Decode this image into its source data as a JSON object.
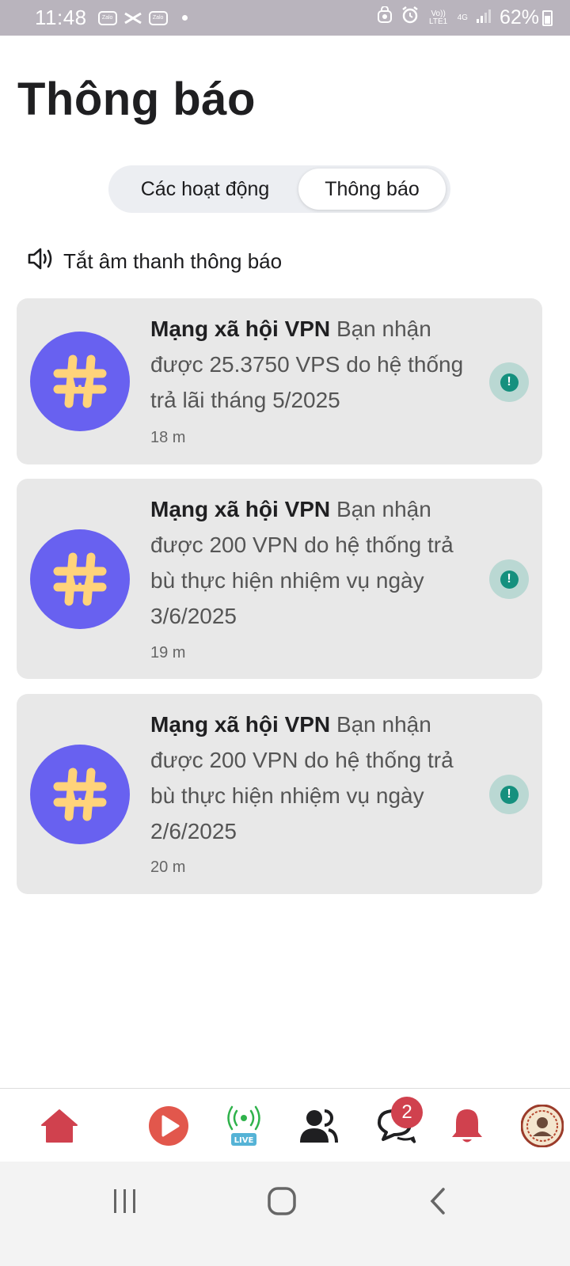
{
  "status_bar": {
    "time": "11:48",
    "notification_icons": [
      "zalo-icon",
      "capcut-icon",
      "zalo-icon"
    ],
    "volte_label": "Vo)) LTE1",
    "network_label": "4G",
    "battery": "62%"
  },
  "page": {
    "title": "Thông báo"
  },
  "tabs": [
    {
      "label": "Các hoạt động",
      "active": false
    },
    {
      "label": "Thông báo",
      "active": true
    }
  ],
  "mute_label": "Tắt âm thanh thông báo",
  "notifications": [
    {
      "sender": "Mạng xã hội VPN",
      "message": "Bạn nhận được 25.3750 VPS do hệ thống trả lãi tháng 5/2025",
      "time": "18 m"
    },
    {
      "sender": "Mạng xã hội VPN",
      "message": "Bạn nhận được 200 VPN do hệ thống trả bù thực hiện nhiệm vụ ngày 3/6/2025",
      "time": "19 m"
    },
    {
      "sender": "Mạng xã hội VPN",
      "message": "Bạn nhận được 200 VPN do hệ thống trả bù thực hiện nhiệm vụ ngày 2/6/2025",
      "time": "20 m"
    }
  ],
  "bottom_nav": {
    "items": [
      "home-icon",
      "video-play-icon",
      "live-icon",
      "friends-icon",
      "chat-icon",
      "bell-icon",
      "profile-avatar"
    ],
    "live_label": "LIVE",
    "chat_badge": "2"
  },
  "colors": {
    "accent_red": "#d0414e",
    "avatar_purple": "#6861f0",
    "card_bg": "#e8e8e8",
    "alert_teal": "#15907e"
  }
}
